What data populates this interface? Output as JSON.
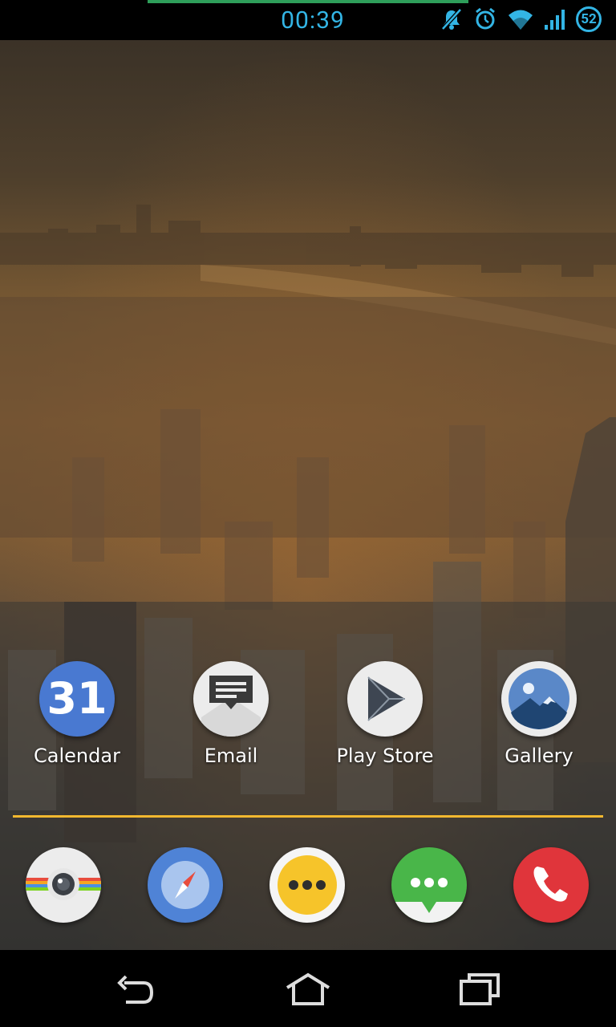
{
  "status_bar": {
    "time": "00:39",
    "battery_level": "52",
    "icons": [
      "notifications-muted-icon",
      "alarm-icon",
      "wifi-icon",
      "signal-icon",
      "battery-icon"
    ],
    "accent": "#33b5e5"
  },
  "home": {
    "apps": [
      {
        "label": "Calendar",
        "icon": "calendar-icon",
        "badge": "31"
      },
      {
        "label": "Email",
        "icon": "email-icon"
      },
      {
        "label": "Play Store",
        "icon": "play-store-icon"
      },
      {
        "label": "Gallery",
        "icon": "gallery-icon"
      }
    ]
  },
  "dock": {
    "divider_color": "#f2b82f",
    "items": [
      {
        "icon": "camera-icon"
      },
      {
        "icon": "browser-compass-icon"
      },
      {
        "icon": "app-drawer-icon"
      },
      {
        "icon": "messaging-icon"
      },
      {
        "icon": "phone-icon"
      }
    ]
  },
  "nav_bar": {
    "buttons": [
      "back-icon",
      "home-icon",
      "recents-icon"
    ]
  }
}
